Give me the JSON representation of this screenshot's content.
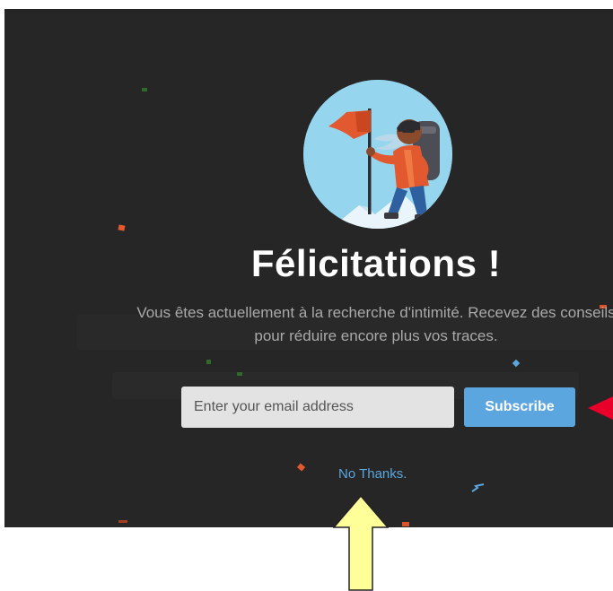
{
  "popup": {
    "title": "Félicitations !",
    "message": "Vous êtes actuellement à la recherche d'intimité. Recevez des conseils pour réduire encore plus vos traces.",
    "email_placeholder": "Enter your email address",
    "subscribe_label": "Subscribe",
    "no_thanks_label": "No Thanks."
  },
  "illustration": {
    "subject": "hiker-with-flag"
  },
  "colors": {
    "overlay_background": "#262626",
    "accent": "#5ba6df",
    "title_text": "#ffffff",
    "message_text": "#a9a9a9",
    "input_background": "#e3e3e3",
    "confetti_orange": "#e2582f",
    "annotation_red": "#e8002a",
    "annotation_yellow": "#ffff99"
  },
  "annotations": {
    "red_arrow": "pointing-left",
    "yellow_arrow": "pointing-up"
  }
}
